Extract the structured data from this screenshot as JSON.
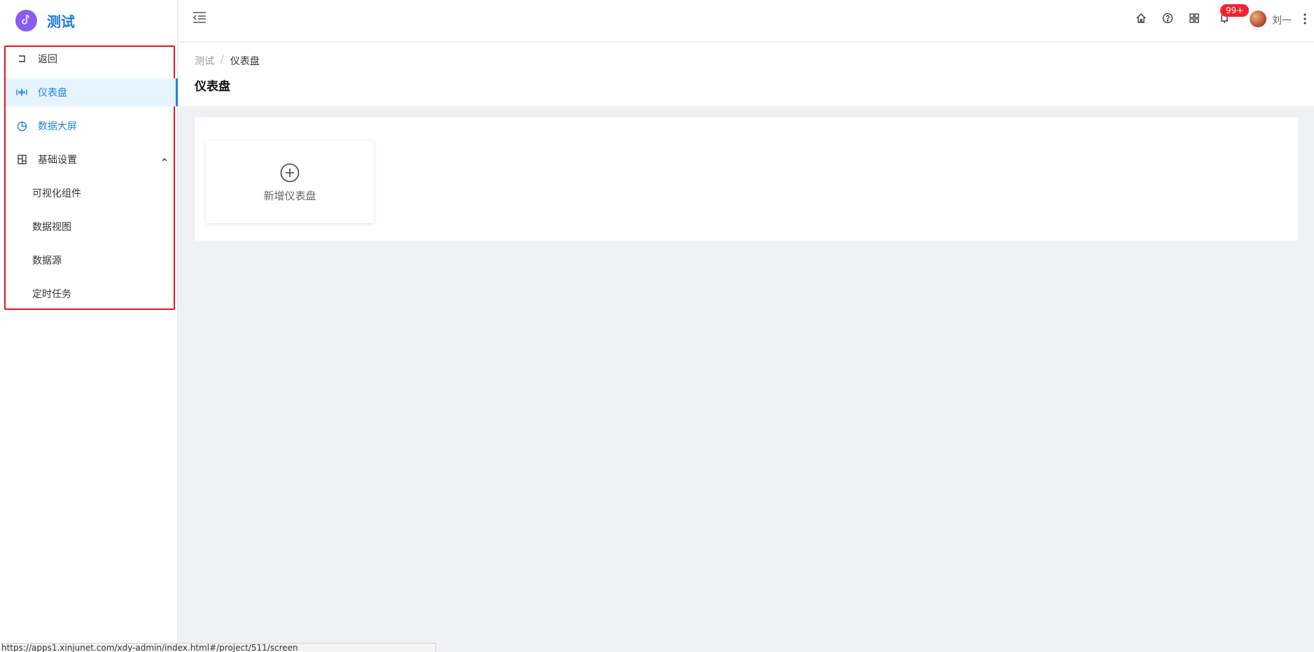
{
  "brand": {
    "title": "测试"
  },
  "sidebar": {
    "back_label": "返回",
    "items": [
      {
        "label": "仪表盘",
        "icon": "dashboard-icon"
      },
      {
        "label": "数据大屏",
        "icon": "pie-chart-icon"
      },
      {
        "label": "基础设置",
        "icon": "settings-icon"
      }
    ],
    "sub_items": [
      "可视化组件",
      "数据视图",
      "数据源",
      "定时任务"
    ]
  },
  "header": {
    "icons": [
      "home-icon",
      "help-icon",
      "apps-icon",
      "bell-icon"
    ],
    "notification_badge": "99+",
    "username": "刘一"
  },
  "page": {
    "breadcrumb": [
      "测试",
      "仪表盘"
    ],
    "breadcrumb_separator": "/",
    "title": "仪表盘"
  },
  "content": {
    "add_dashboard_label": "新增仪表盘"
  },
  "status_bar": {
    "url": "https://apps1.xinjunet.com/xdy-admin/index.html#/project/511/screen"
  },
  "colors": {
    "accent": "#1f84e3",
    "brand_logo": "#8a5cf5",
    "highlight_border": "#e8141f",
    "badge": "#f5222d"
  }
}
